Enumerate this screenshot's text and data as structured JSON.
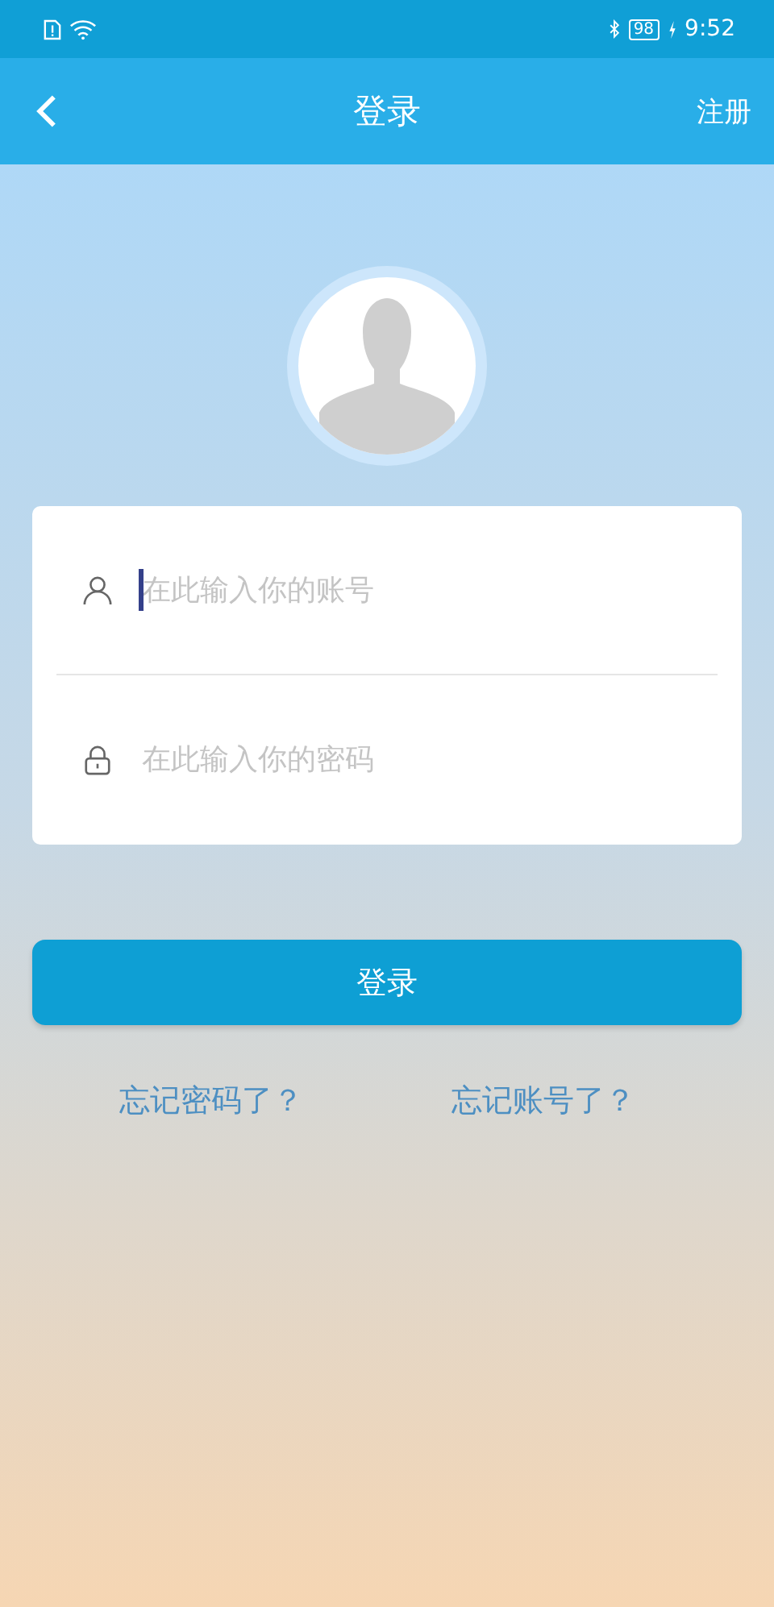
{
  "status_bar": {
    "battery": "98",
    "time": "9:52"
  },
  "nav": {
    "title": "登录",
    "action": "注册"
  },
  "fields": [
    {
      "kind": "account",
      "placeholder": "在此输入你的账号",
      "focused": true
    },
    {
      "kind": "password",
      "placeholder": "在此输入你的密码",
      "focused": false
    }
  ],
  "login_button": "登录",
  "links": [
    "忘记密码了？",
    "忘记账号了？"
  ]
}
